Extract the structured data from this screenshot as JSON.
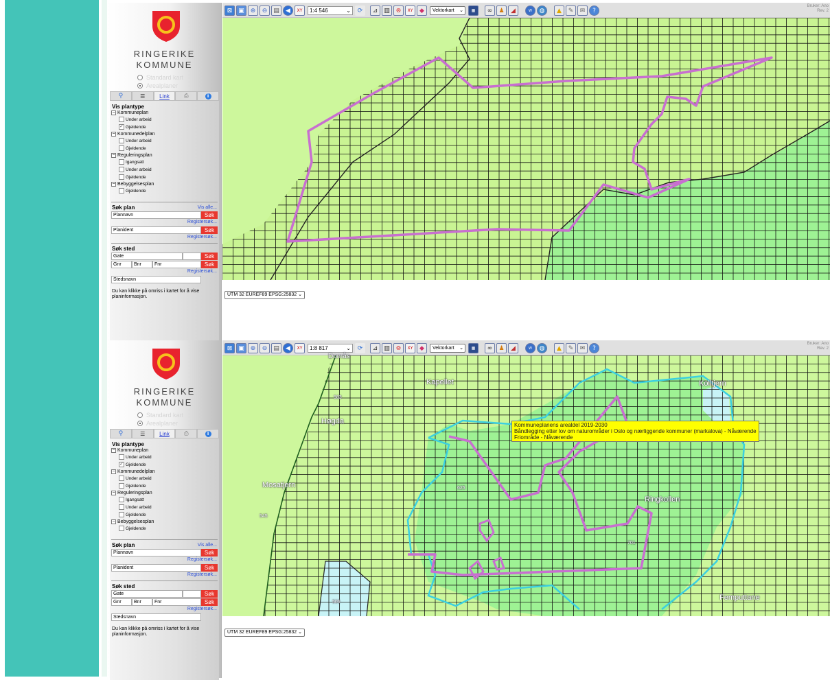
{
  "panels": [
    {
      "municipality": {
        "line1": "RINGERIKE",
        "line2": "KOMMUNE"
      },
      "map_options": [
        "Standard kart",
        "Arealplaner"
      ],
      "tabs": {
        "link": "Link"
      },
      "vis_plantype": {
        "title": "Vis plantype",
        "kommuneplan": "Kommuneplan",
        "kp_under": "Under arbeid",
        "kp_gjeld": "Gjeldende",
        "kommunedelplan": "Kommunedelplan",
        "kdp_under": "Under arbeid",
        "kdp_gjeld": "Gjeldende",
        "reguleringsplan": "Reguleringsplan",
        "rp_igang": "Igangsatt",
        "rp_under": "Under arbeid",
        "rp_gjeld": "Gjeldende",
        "bebyggelsesplan": "Bebyggelsesplan",
        "bp_gjeld": "Gjeldende"
      },
      "sok_plan": {
        "title": "Søk plan",
        "vis_alle": "Vis alle...",
        "plannavn": "Plannavn",
        "planident": "Planident",
        "sok": "Søk",
        "register": "Registersøk..."
      },
      "sok_sted": {
        "title": "Søk sted",
        "gate": "Gate",
        "gnr": "Gnr",
        "bnr": "Bnr",
        "fnr": "Fnr",
        "sok": "Søk",
        "register": "Registersøk...",
        "stedsnavn": "Stedsnavn"
      },
      "hint": "Du kan klikke på omriss i kartet for å vise planinformasjon.",
      "toolbar": {
        "scale": "1:4 546",
        "layer": "Vektorkart",
        "user_line1": "Bruker: Ano",
        "user_line2": "Rev. 2"
      },
      "projection": "UTM 32 EUREF89 EPSG:25832"
    },
    {
      "municipality": {
        "line1": "RINGERIKE",
        "line2": "KOMMUNE"
      },
      "map_options": [
        "Standard kart",
        "Arealplaner"
      ],
      "tabs": {
        "link": "Link"
      },
      "vis_plantype": {
        "title": "Vis plantype",
        "kommuneplan": "Kommuneplan",
        "kp_under": "Under arbeid",
        "kp_gjeld": "Gjeldende",
        "kommunedelplan": "Kommunedelplan",
        "kdp_under": "Under arbeid",
        "kdp_gjeld": "Gjeldende",
        "reguleringsplan": "Reguleringsplan",
        "rp_igang": "Igangsatt",
        "rp_under": "Under arbeid",
        "rp_gjeld": "Gjeldende",
        "bebyggelsesplan": "Bebyggelsesplan",
        "bp_gjeld": "Gjeldende"
      },
      "sok_plan": {
        "title": "Søk plan",
        "vis_alle": "Vis alle...",
        "plannavn": "Plannavn",
        "planident": "Planident",
        "sok": "Søk",
        "register": "Registersøk..."
      },
      "sok_sted": {
        "title": "Søk sted",
        "gate": "Gate",
        "gnr": "Gnr",
        "bnr": "Bnr",
        "fnr": "Fnr",
        "sok": "Søk",
        "register": "Registersøk...",
        "stedsnavn": "Stedsnavn"
      },
      "hint": "Du kan klikke på omriss i kartet for å vise planinformasjon.",
      "toolbar": {
        "scale": "1:8 817",
        "layer": "Vektorkart",
        "user_line1": "Bruker: Ano",
        "user_line2": "Rev. 2"
      },
      "projection": "UTM 32 EUREF89 EPSG:25832",
      "tooltip": {
        "line1": "Kommuneplanens arealdel 2019-2030",
        "line2": "Båndlegging etter lov om naturområder i Oslo og nærliggende kommuner (markalova) - Nåværende",
        "line3": "Friområde - Nåværende"
      },
      "place_names": {
        "kapellet": "Kapellet",
        "hogda": "Høgda",
        "mosatjern": "Mosatjern",
        "kolltjern": "Kolltjern",
        "ringkollen": "Ringkollen",
        "femputtane": "Femputtane",
        "domas": "Domås",
        "h583": "583",
        "h625": "625",
        "h545": "545",
        "h701": "701",
        "h506": "506"
      }
    }
  ],
  "colors": {
    "teal": "#44c4b8",
    "map_light": "#cdf79c",
    "map_green": "#9ef294",
    "plan_pink": "#c86fd0",
    "plan_cyan": "#3bd0e0",
    "search_red": "#e8382f",
    "tooltip": "#ffff00"
  },
  "icons": [
    "zoom-extent-icon",
    "zoom-box-icon",
    "zoom-in-icon",
    "zoom-out-icon",
    "print-icon",
    "back-icon",
    "xy-icon",
    "refresh-icon",
    "measure-icon",
    "document-icon",
    "rights-icon",
    "xy2-icon",
    "eraser-icon",
    "layer-icon",
    "wms-icon",
    "globe-icon",
    "lock-icon",
    "edit-icon",
    "email-icon",
    "help-icon"
  ]
}
